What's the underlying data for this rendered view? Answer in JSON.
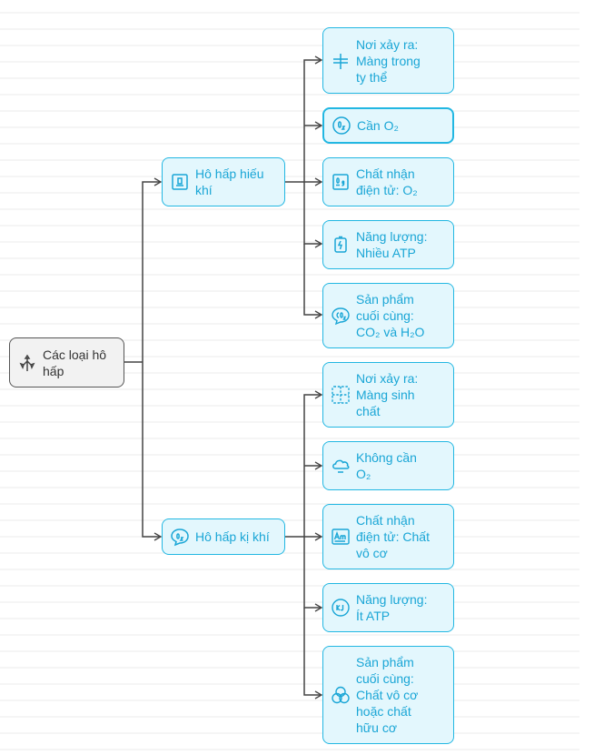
{
  "root": {
    "label": "Các loại hô\nhấp",
    "icon": "branch-split-icon"
  },
  "branches": [
    {
      "label": "Hô hấp hiếu\nkhí",
      "icon": "scale-icon",
      "children": [
        {
          "label": "Nơi xảy ra:\nMàng trong\nty thể",
          "icon": "membrane-icon"
        },
        {
          "label": "Cần O₂",
          "icon": "oxygen-circle-icon"
        },
        {
          "label": "Chất nhận\nđiện tử: O₂",
          "icon": "element-box-icon"
        },
        {
          "label": "Năng lượng:\nNhiều ATP",
          "icon": "battery-cycle-icon"
        },
        {
          "label": "Sản phẩm\ncuối cùng:\nCO₂ và H₂O",
          "icon": "co2-bubble-icon"
        }
      ]
    },
    {
      "label": "Hô hấp kị khí",
      "icon": "oxygen-bubble-icon",
      "children": [
        {
          "label": "Nơi xảy ra:\nMàng sinh\nchất",
          "icon": "dashed-grid-icon"
        },
        {
          "label": "Không cần\nO₂",
          "icon": "cloud-icon"
        },
        {
          "label": "Chất nhận\nđiện tử: Chất\nvô cơ",
          "icon": "am-box-icon"
        },
        {
          "label": "Năng lượng:\nÍt ATP",
          "icon": "kj-circle-icon"
        },
        {
          "label": "Sản phẩm\ncuối cùng:\nChất vô cơ\nhoặc chất\nhữu cơ",
          "icon": "molecule-cluster-icon"
        }
      ]
    }
  ]
}
